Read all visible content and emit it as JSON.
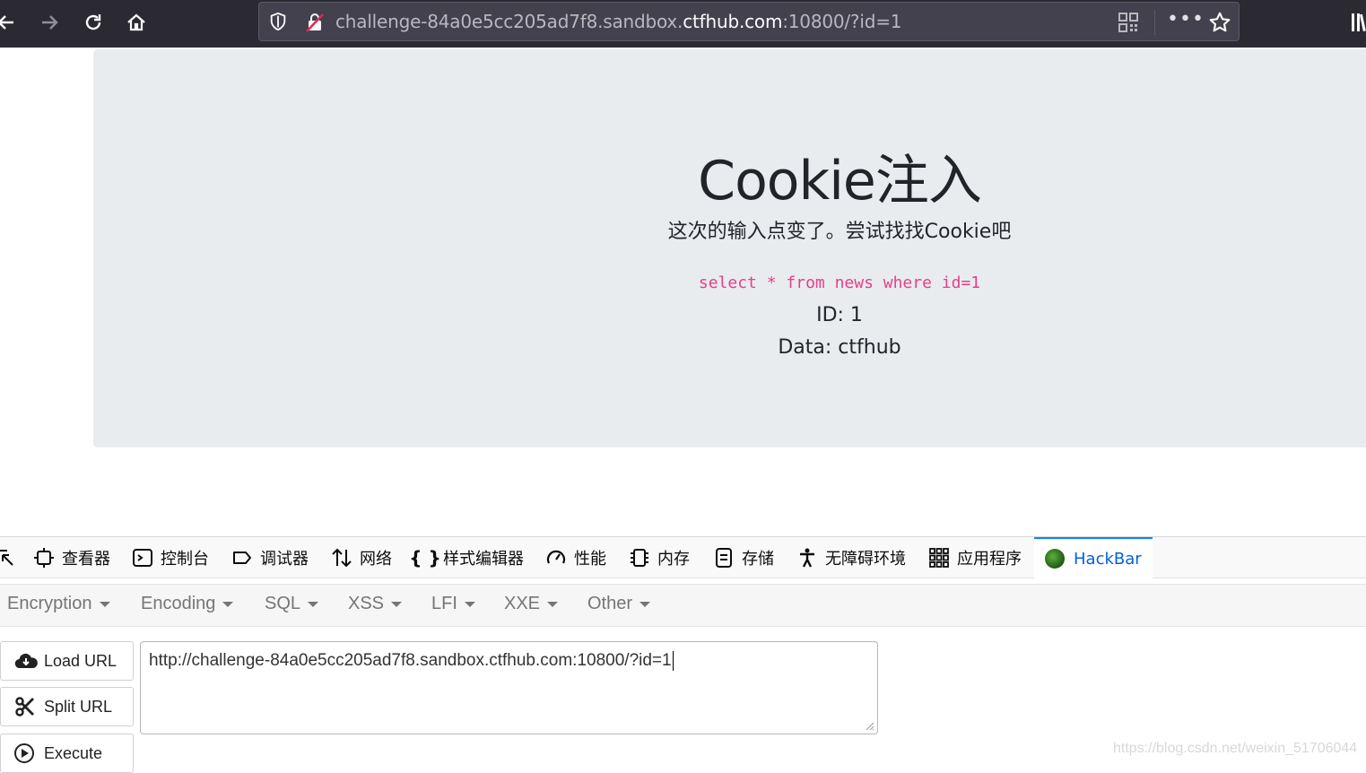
{
  "browser": {
    "url_prefix": "challenge-84a0e5cc205ad7f8.sandbox.",
    "url_domain": "ctfhub.com",
    "url_suffix": ":10800/?id=1"
  },
  "page": {
    "title": "Cookie注入",
    "subtitle": "这次的输入点变了。尝试找找Cookie吧",
    "sql": "select * from news where id=1",
    "id_line": "ID: 1",
    "data_line": "Data: ctfhub"
  },
  "devtools": {
    "tabs": [
      {
        "label": "查看器",
        "icon": "inspector-icon"
      },
      {
        "label": "控制台",
        "icon": "console-icon"
      },
      {
        "label": "调试器",
        "icon": "debugger-icon"
      },
      {
        "label": "网络",
        "icon": "network-icon"
      },
      {
        "label": "样式编辑器",
        "icon": "style-editor-icon"
      },
      {
        "label": "性能",
        "icon": "performance-icon"
      },
      {
        "label": "内存",
        "icon": "memory-icon"
      },
      {
        "label": "存储",
        "icon": "storage-icon"
      },
      {
        "label": "无障碍环境",
        "icon": "accessibility-icon"
      },
      {
        "label": "应用程序",
        "icon": "application-icon"
      },
      {
        "label": "HackBar",
        "icon": "hackbar-icon"
      }
    ],
    "active_tab": "HackBar"
  },
  "hackbar": {
    "menu": [
      "Encryption",
      "Encoding",
      "SQL",
      "XSS",
      "LFI",
      "XXE",
      "Other"
    ],
    "load_url": "Load URL",
    "split_url": "Split URL",
    "execute": "Execute",
    "url_value": "http://challenge-84a0e5cc205ad7f8.sandbox.ctfhub.com:10800/?id=1"
  },
  "watermark": "https://blog.csdn.net/weixin_51706044",
  "colors": {
    "toolbar": "#2b2a33",
    "jumbotron": "#e9ecef",
    "sql_pink": "#e83e8c",
    "active_tab": "#0060df"
  }
}
